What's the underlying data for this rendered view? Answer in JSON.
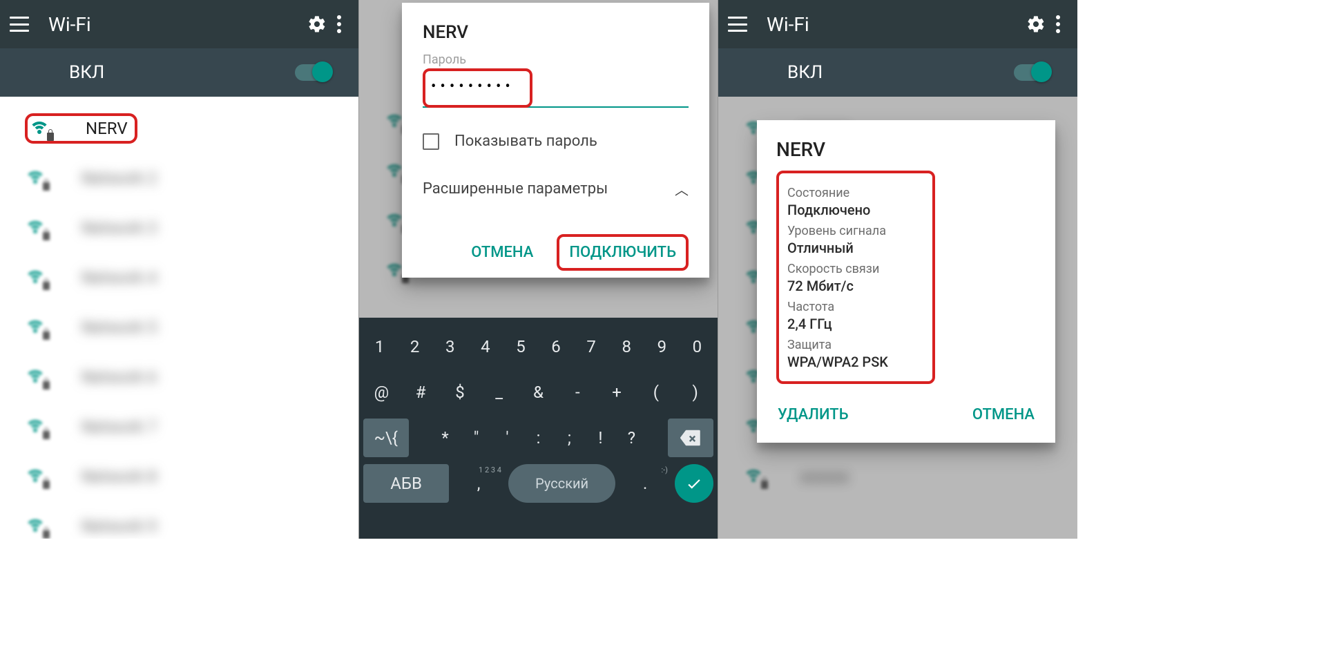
{
  "colors": {
    "teal": "#009688",
    "red": "#d82121"
  },
  "panel1": {
    "title": "Wi-Fi",
    "toggle_label": "ВКЛ",
    "networks": [
      {
        "name": "NERV",
        "highlighted": true
      },
      {
        "name": "Network 2",
        "blurred": true
      },
      {
        "name": "Network 3",
        "blurred": true
      },
      {
        "name": "Network 4",
        "blurred": true
      },
      {
        "name": "Network 5",
        "blurred": true
      },
      {
        "name": "Network 6",
        "blurred": true
      },
      {
        "name": "Network 7",
        "blurred": true
      },
      {
        "name": "Network 8",
        "blurred": true
      },
      {
        "name": "Network 9",
        "blurred": true
      }
    ]
  },
  "panel2": {
    "dialog": {
      "network_name": "NERV",
      "password_label": "Пароль",
      "password_masked": "•••••••••",
      "show_password_label": "Показывать пароль",
      "advanced_label": "Расширенные параметры",
      "cancel_label": "ОТМЕНА",
      "connect_label": "ПОДКЛЮЧИТЬ"
    },
    "keyboard": {
      "row1": [
        "1",
        "2",
        "3",
        "4",
        "5",
        "6",
        "7",
        "8",
        "9",
        "0"
      ],
      "row2": [
        "@",
        "#",
        "$",
        "_",
        "&",
        "-",
        "+",
        "(",
        ")"
      ],
      "row3_shift": "~\\{",
      "row3": [
        "*",
        "\"",
        "'",
        ":",
        ";",
        "!",
        "?"
      ],
      "row3_backspace_icon": "backspace-icon",
      "row4_mode": "АБВ",
      "row4_superscript": "1 2\n3 4",
      "row4_language": "Русский",
      "row4_emoji": ":-)",
      "row4_go_icon": "check-icon"
    }
  },
  "panel3": {
    "title": "Wi-Fi",
    "toggle_label": "ВКЛ",
    "dialog": {
      "network_name": "NERV",
      "items": [
        {
          "label": "Состояние",
          "value": "Подключено"
        },
        {
          "label": "Уровень сигнала",
          "value": "Отличный"
        },
        {
          "label": "Скорость связи",
          "value": "72 Мбит/с"
        },
        {
          "label": "Частота",
          "value": "2,4 ГГц"
        },
        {
          "label": "Защита",
          "value": "WPA/WPA2 PSK"
        }
      ],
      "forget_label": "УДАЛИТЬ",
      "cancel_label": "ОТМЕНА"
    }
  }
}
